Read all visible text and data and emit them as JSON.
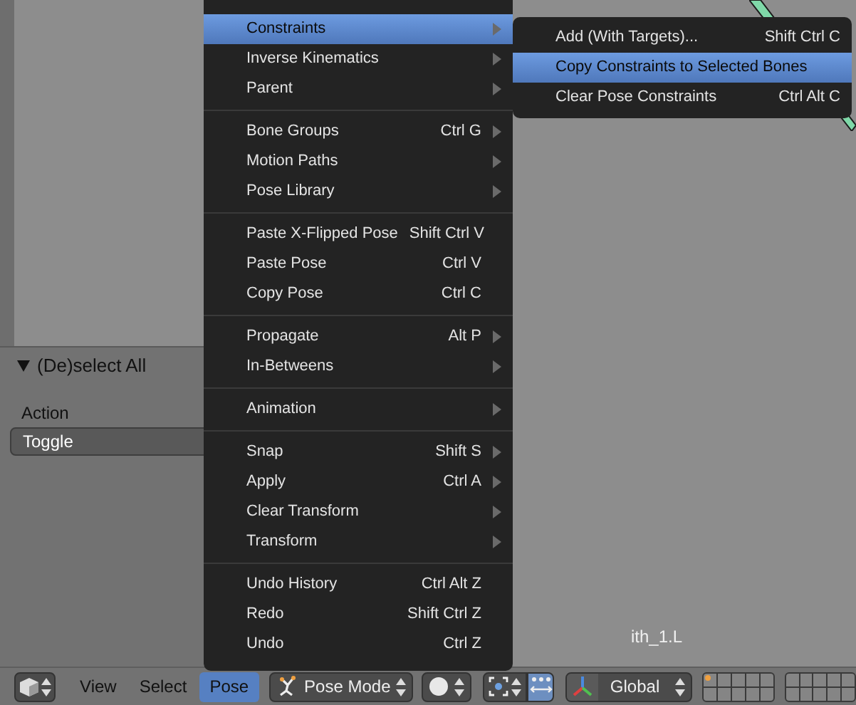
{
  "tool_panel": {
    "title": "(De)select All",
    "expanded": true,
    "field_label": "Action",
    "value": "Toggle"
  },
  "viewport": {
    "label": "ith_1.L"
  },
  "menu": {
    "sections": [
      [
        {
          "label": "Constraints",
          "submenu": true,
          "selected": true
        },
        {
          "label": "Inverse Kinematics",
          "submenu": true,
          "selected": false
        },
        {
          "label": "Parent",
          "submenu": true,
          "selected": false
        }
      ],
      [
        {
          "label": "Bone Groups",
          "shortcut": "Ctrl G",
          "submenu": true,
          "selected": false
        },
        {
          "label": "Motion Paths",
          "submenu": true,
          "selected": false
        },
        {
          "label": "Pose Library",
          "submenu": true,
          "selected": false
        }
      ],
      [
        {
          "label": "Paste X-Flipped Pose",
          "shortcut": "Shift Ctrl V",
          "submenu": false,
          "selected": false
        },
        {
          "label": "Paste Pose",
          "shortcut": "Ctrl V",
          "submenu": false,
          "selected": false
        },
        {
          "label": "Copy Pose",
          "shortcut": "Ctrl C",
          "submenu": false,
          "selected": false
        }
      ],
      [
        {
          "label": "Propagate",
          "shortcut": "Alt P",
          "submenu": true,
          "selected": false
        },
        {
          "label": "In-Betweens",
          "submenu": true,
          "selected": false
        }
      ],
      [
        {
          "label": "Animation",
          "submenu": true,
          "selected": false
        }
      ],
      [
        {
          "label": "Snap",
          "shortcut": "Shift S",
          "submenu": true,
          "selected": false
        },
        {
          "label": "Apply",
          "shortcut": "Ctrl A",
          "submenu": true,
          "selected": false
        },
        {
          "label": "Clear Transform",
          "submenu": true,
          "selected": false
        },
        {
          "label": "Transform",
          "submenu": true,
          "selected": false
        }
      ],
      [
        {
          "label": "Undo History",
          "shortcut": "Ctrl Alt Z",
          "submenu": false,
          "selected": false
        },
        {
          "label": "Redo",
          "shortcut": "Shift Ctrl Z",
          "submenu": false,
          "selected": false
        },
        {
          "label": "Undo",
          "shortcut": "Ctrl Z",
          "submenu": false,
          "selected": false
        }
      ]
    ]
  },
  "submenu": {
    "items": [
      {
        "label": "Add (With Targets)...",
        "shortcut": "Shift Ctrl C",
        "selected": false
      },
      {
        "label": "Copy Constraints to Selected Bones",
        "selected": true
      },
      {
        "label": "Clear Pose Constraints",
        "shortcut": "Ctrl Alt C",
        "selected": false
      }
    ]
  },
  "header": {
    "menus": [
      {
        "label": "View",
        "selected": false
      },
      {
        "label": "Select",
        "selected": false
      },
      {
        "label": "Pose",
        "selected": true
      }
    ],
    "mode": "Pose Mode",
    "orientation": "Global"
  }
}
